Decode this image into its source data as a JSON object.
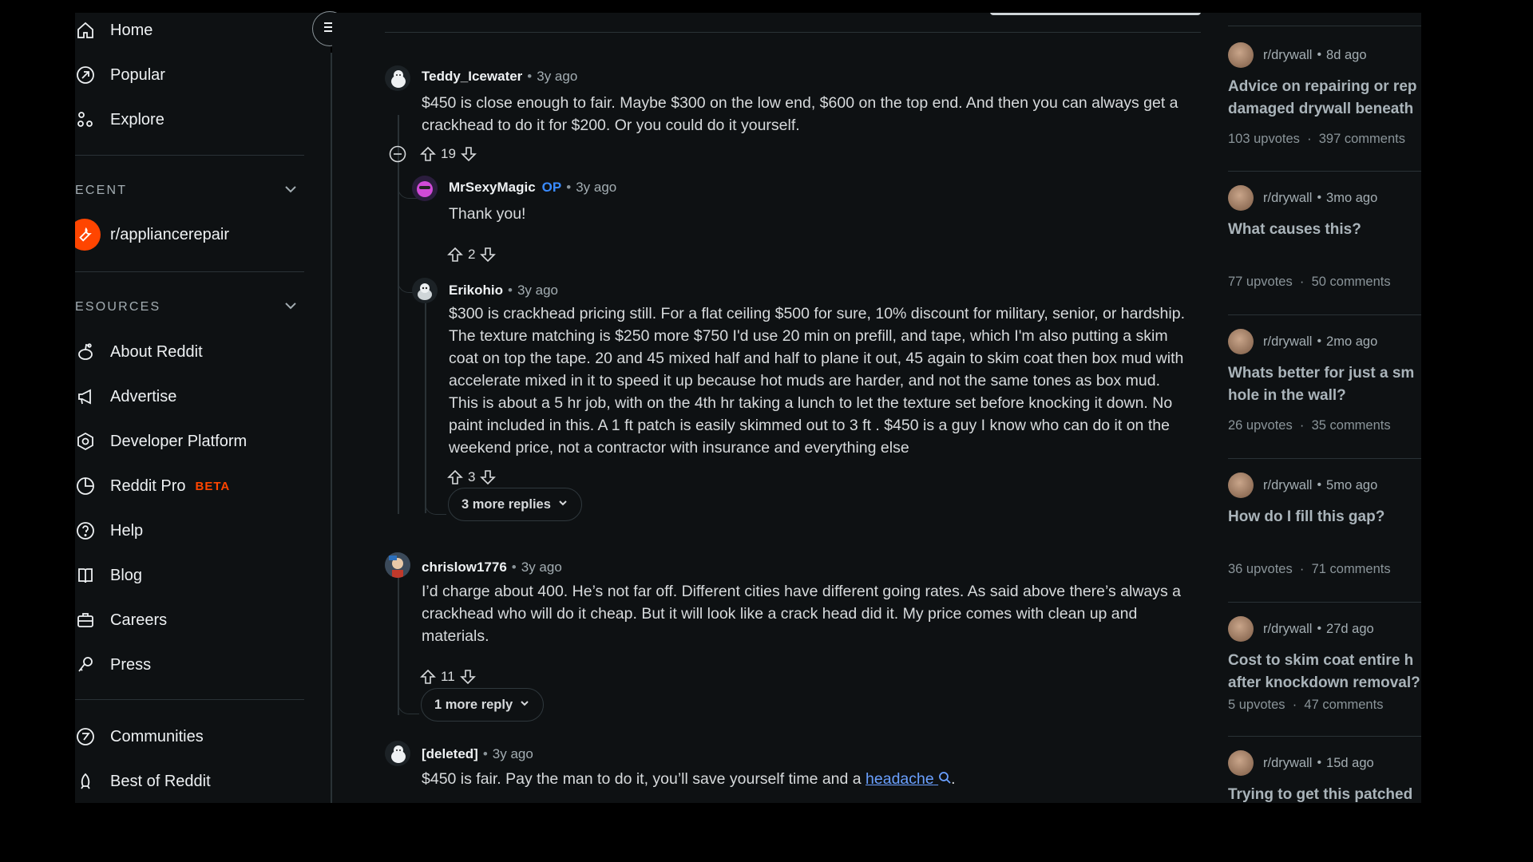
{
  "sidebar": {
    "nav": [
      {
        "label": "Home",
        "icon": "home-icon"
      },
      {
        "label": "Popular",
        "icon": "popular-icon"
      },
      {
        "label": "Explore",
        "icon": "explore-icon"
      }
    ],
    "recent_header": "ECENT",
    "recent_items": [
      {
        "label": "r/appliancerepair",
        "icon": "wrench-icon"
      }
    ],
    "resources_header": "ESOURCES",
    "resources": [
      {
        "label": "About Reddit",
        "icon": "reddit-alien-icon"
      },
      {
        "label": "Advertise",
        "icon": "megaphone-icon"
      },
      {
        "label": "Developer Platform",
        "icon": "hexagon-icon"
      },
      {
        "label": "Reddit Pro",
        "icon": "pro-icon",
        "badge": "BETA"
      },
      {
        "label": "Help",
        "icon": "help-icon"
      },
      {
        "label": "Blog",
        "icon": "book-icon"
      },
      {
        "label": "Careers",
        "icon": "briefcase-icon"
      },
      {
        "label": "Press",
        "icon": "microphone-icon"
      }
    ],
    "bottom": [
      {
        "label": "Communities",
        "icon": "communities-icon"
      },
      {
        "label": "Best of Reddit",
        "icon": "best-of-icon"
      }
    ]
  },
  "comments": [
    {
      "user": "Teddy_Icewater",
      "time": "3y ago",
      "body": "$450 is close enough to fair. Maybe $300 on the low end, $600 on the top end. And then you can always get a crackhead to do it for $200. Or you could do it yourself.",
      "votes": "19"
    },
    {
      "user": "MrSexyMagic",
      "op": "OP",
      "time": "3y ago",
      "body": "Thank you!",
      "votes": "2"
    },
    {
      "user": "Erikohio",
      "time": "3y ago",
      "body": "$300 is crackhead pricing still. For a flat ceiling $500 for sure, 10% discount for military, senior, or hardship. The texture matching is $250 more $750 I'd use 20 min on prefill, and tape, which I'm also putting a skim coat on top the tape. 20 and 45 mixed half and half to plane it out, 45 again to skim coat then box mud with accelerate mixed in it to speed it up because hot muds are harder, and not the same tones as box mud. This is about a 5 hr job, with on the 4th hr taking a lunch to let the texture set before knocking it down. No paint included in this. A 1 ft patch is easily skimmed out to 3 ft . $450 is a guy I know who can do it on the weekend price, not a contractor with insurance and everything else",
      "votes": "3"
    },
    {
      "user": "chrislow1776",
      "time": "3y ago",
      "body": "I’d charge about 400. He’s not far off. Different cities have different going rates. As said above there’s always a crackhead who will do it cheap. But it will look like a crack head did it. My price comes with clean up and materials.",
      "votes": "11"
    },
    {
      "user": "[deleted]",
      "time": "3y ago",
      "body_before": "$450 is fair. Pay the man to do it, you’ll save yourself time and a ",
      "link": "headache",
      "body_after": "."
    }
  ],
  "more_replies": "3 more replies",
  "one_more_reply": "1 more reply",
  "right_posts": [
    {
      "sub": "r/drywall",
      "ago": "8d ago",
      "title1": "Advice on repairing or rep",
      "title2": "damaged drywall beneath",
      "upvotes": "103 upvotes",
      "comments": "397 comments"
    },
    {
      "sub": "r/drywall",
      "ago": "3mo ago",
      "title1": "What causes this?",
      "title2": "",
      "upvotes": "77 upvotes",
      "comments": "50 comments"
    },
    {
      "sub": "r/drywall",
      "ago": "2mo ago",
      "title1": "Whats better for just a sm",
      "title2": "hole in the wall?",
      "upvotes": "26 upvotes",
      "comments": "35 comments"
    },
    {
      "sub": "r/drywall",
      "ago": "5mo ago",
      "title1": "How do I fill this gap?",
      "title2": "",
      "upvotes": "36 upvotes",
      "comments": "71 comments"
    },
    {
      "sub": "r/drywall",
      "ago": "27d ago",
      "title1": "Cost to skim coat entire h",
      "title2": "after knockdown removal?",
      "upvotes": "5 upvotes",
      "comments": "47 comments"
    },
    {
      "sub": "r/drywall",
      "ago": "15d ago",
      "title1": "Trying to get this patched",
      "title2": "",
      "upvotes": "",
      "comments": ""
    }
  ],
  "colors": {
    "accent": "#ff4500",
    "op": "#3a8bff",
    "link": "#6aa0ff",
    "bg": "#0e1113"
  }
}
